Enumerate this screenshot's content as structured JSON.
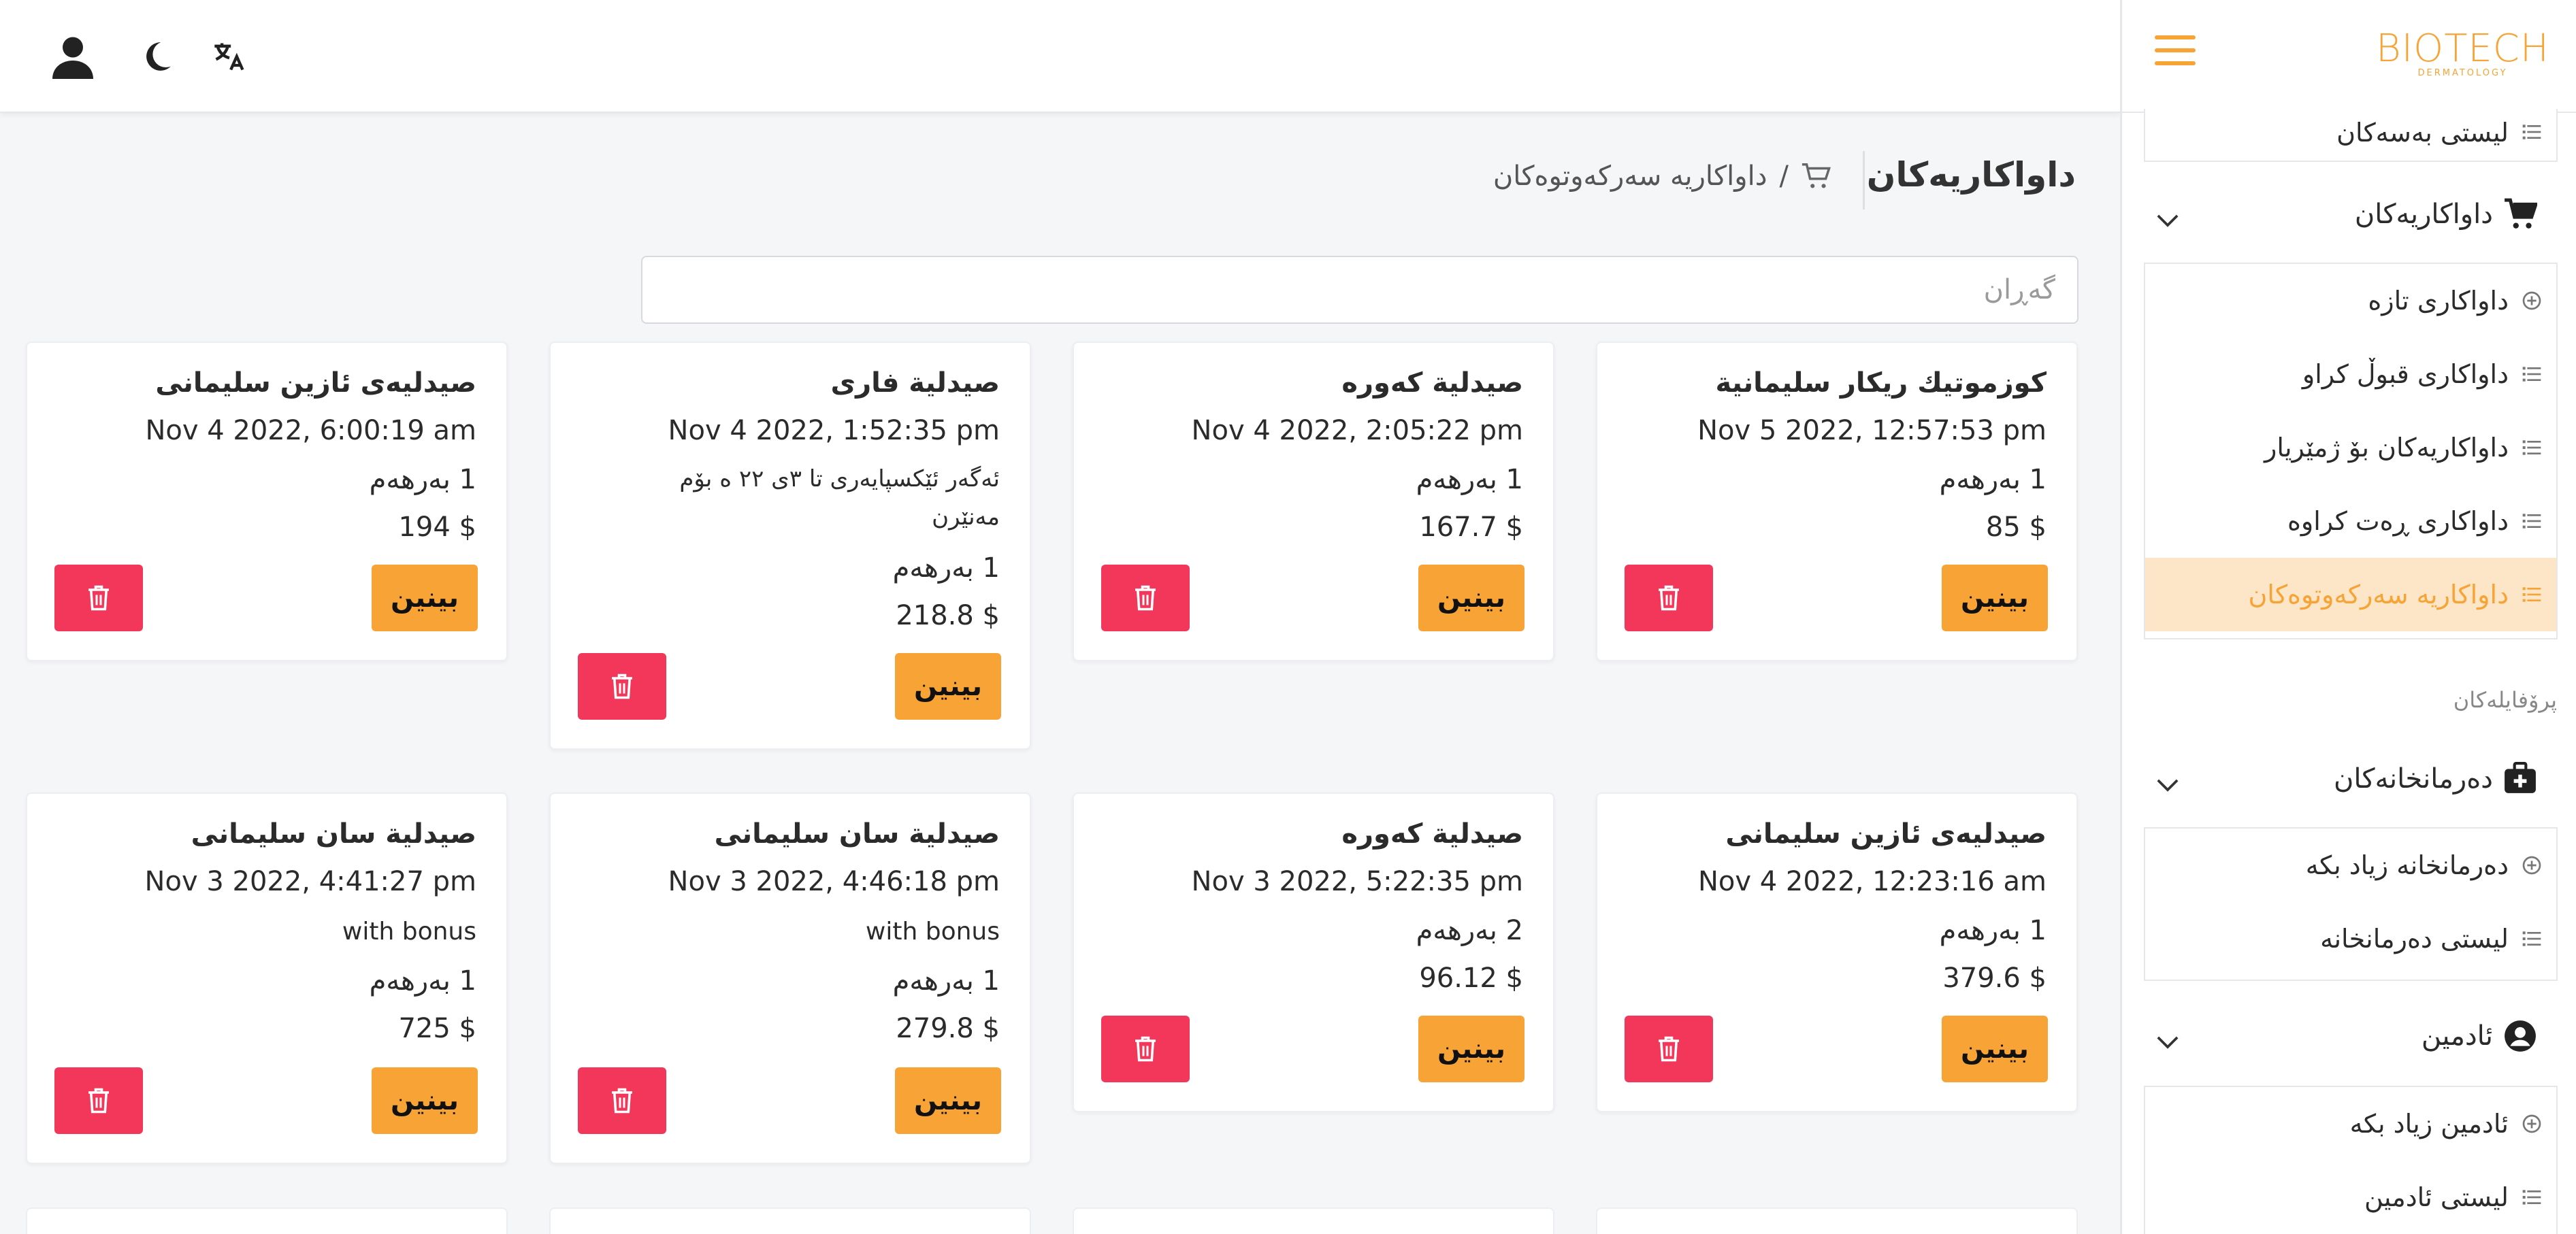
{
  "header": {
    "icons": [
      "user-icon",
      "moon-icon",
      "translate-icon"
    ]
  },
  "sidebar": {
    "brand": {
      "name": "BIOTECH",
      "tagline": "DERMATOLOGY"
    },
    "accent": "#f7a335",
    "top_item": "لیستی بەسەکان",
    "orders_group": {
      "label": "داواکاریەکان",
      "items": [
        {
          "label": "داواکاری تازە",
          "icon": "plus-circle-icon"
        },
        {
          "label": "داواکاری قبوڵ کراو",
          "icon": "list-icon"
        },
        {
          "label": "داواکاریەکان بۆ ژمێریار",
          "icon": "list-icon"
        },
        {
          "label": "داواکاری ڕەت کراوە",
          "icon": "list-icon"
        },
        {
          "label": "داواکاریە سەرکەوتوەکان",
          "icon": "list-icon",
          "active": true
        }
      ]
    },
    "profiles_heading": "پرۆفایلەکان",
    "pharmacies_group": {
      "label": "دەرمانخانەکان",
      "items": [
        {
          "label": "دەرمانخانە زیاد بکە",
          "icon": "plus-circle-icon"
        },
        {
          "label": "لیستی دەرمانخانە",
          "icon": "list-icon"
        }
      ]
    },
    "admins_group": {
      "label": "ئادمین",
      "items": [
        {
          "label": "ئادمین زیاد بکە",
          "icon": "plus-circle-icon"
        },
        {
          "label": "لیستی ئادمین",
          "icon": "list-icon"
        }
      ]
    }
  },
  "main": {
    "title": "داواکاریەکان",
    "breadcrumb": {
      "separator": "/",
      "current": "داواکاریە سەرکەوتوەکان"
    },
    "search": {
      "placeholder": "گەڕان",
      "value": ""
    },
    "view_label": "بینین",
    "orders": [
      {
        "name": "کوزموتیك ریكار سلیمانیة",
        "date": "Nov 5 2022, 12:57:53 pm",
        "items": "1 بەرهەم",
        "price": "$ 85"
      },
      {
        "name": "صیدلیة کەوره",
        "date": "Nov 4 2022, 2:05:22 pm",
        "items": "1 بەرهەم",
        "price": "$ 167.7"
      },
      {
        "name": "صیدلیة فاری",
        "date": "Nov 4 2022, 1:52:35 pm",
        "note": "ئەگەر ئێکسپایەری تا ٣ی ٢٢ ە بۆم مەنێرن",
        "items": "1 بەرهەم",
        "price": "$ 218.8"
      },
      {
        "name": "صیدلیەی ئازین سلیمانی",
        "date": "Nov 4 2022, 6:00:19 am",
        "items": "1 بەرهەم",
        "price": "$ 194"
      },
      {
        "name": "صیدلیەی ئازین سلیمانی",
        "date": "Nov 4 2022, 12:23:16 am",
        "items": "1 بەرهەم",
        "price": "$ 379.6"
      },
      {
        "name": "صیدلیة کەوره",
        "date": "Nov 3 2022, 5:22:35 pm",
        "items": "2 بەرهەم",
        "price": "$ 96.12"
      },
      {
        "name": "صیدلیة سان سلیمانی",
        "date": "Nov 3 2022, 4:46:18 pm",
        "note": "with bonus",
        "items": "1 بەرهەم",
        "price": "$ 279.8"
      },
      {
        "name": "صیدلیة سان سلیمانی",
        "date": "Nov 3 2022, 4:41:27 pm",
        "note": "with bonus",
        "items": "1 بەرهەم",
        "price": "$ 725"
      }
    ]
  }
}
